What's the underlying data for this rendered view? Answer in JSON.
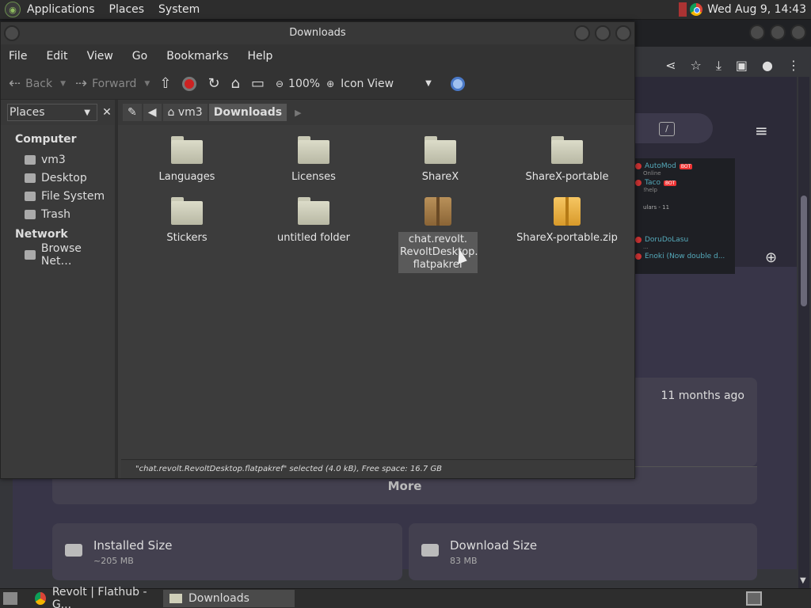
{
  "top_panel": {
    "menus": [
      "Applications",
      "Places",
      "System"
    ],
    "clock": "Wed Aug  9, 14:43"
  },
  "browser": {
    "time_ago": "11 months ago",
    "more_label": "More",
    "installed_size_label": "Installed Size",
    "installed_size_value": "~205 MB",
    "download_size_label": "Download Size",
    "download_size_value": "83 MB",
    "search_shortcut": "/",
    "screenshot_preview": {
      "users": [
        {
          "name": "AutoMod",
          "sub": "Online",
          "badge": "BOT"
        },
        {
          "name": "Taco",
          "sub": "!help",
          "badge": "BOT"
        }
      ],
      "group": "ulars - 11",
      "more_users": [
        {
          "name": "DoruDoLasu",
          "sub": "..."
        },
        {
          "name": "Enoki (Now double d...",
          "sub": ""
        }
      ]
    }
  },
  "file_manager": {
    "title": "Downloads",
    "menu": [
      "File",
      "Edit",
      "View",
      "Go",
      "Bookmarks",
      "Help"
    ],
    "toolbar": {
      "back": "Back",
      "forward": "Forward",
      "zoom": "100%",
      "view_mode": "Icon View"
    },
    "sidebar_selector": "Places",
    "breadcrumbs": [
      "vm3",
      "Downloads"
    ],
    "sidebar": {
      "sections": [
        {
          "heading": "Computer",
          "items": [
            "vm3",
            "Desktop",
            "File System",
            "Trash"
          ]
        },
        {
          "heading": "Network",
          "items": [
            "Browse Net…"
          ]
        }
      ]
    },
    "files": [
      {
        "name": "Languages",
        "type": "folder"
      },
      {
        "name": "Licenses",
        "type": "folder"
      },
      {
        "name": "ShareX",
        "type": "folder"
      },
      {
        "name": "ShareX-portable",
        "type": "folder"
      },
      {
        "name": "Stickers",
        "type": "folder"
      },
      {
        "name": "untitled folder",
        "type": "folder"
      },
      {
        "name": "chat.revolt.RevoltDesktop.flatpakref",
        "line1": "chat.revolt.",
        "line2": "RevoltDesktop.",
        "line3": "flatpakref",
        "type": "package",
        "selected": true
      },
      {
        "name": "ShareX-portable.zip",
        "type": "zip"
      }
    ],
    "status": "\"chat.revolt.RevoltDesktop.flatpakref\" selected (4.0 kB), Free space: 16.7 GB"
  },
  "taskbar": {
    "tasks": [
      {
        "label": "Revolt | Flathub - G...",
        "active": false
      },
      {
        "label": "Downloads",
        "active": true
      }
    ]
  }
}
